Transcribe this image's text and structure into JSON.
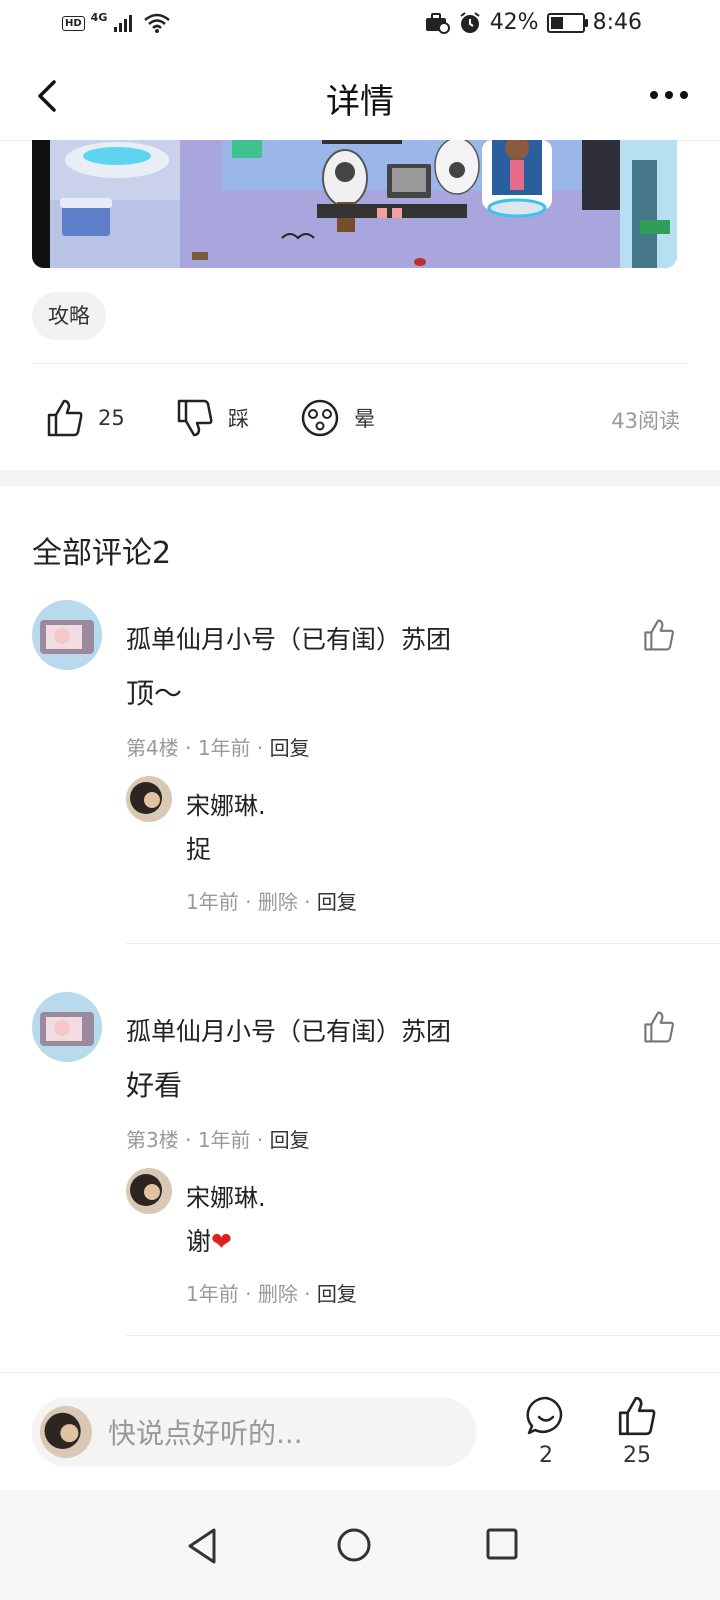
{
  "status_bar": {
    "hd": "HD",
    "network": "4G",
    "battery": "42%",
    "battery_level": 0.42,
    "time": "8:46"
  },
  "header": {
    "title": "详情"
  },
  "post": {
    "tag": "攻略",
    "like_count": "25",
    "dislike_label": "踩",
    "dizzy_label": "晕",
    "reads": "43阅读"
  },
  "comments_section": {
    "title": "全部评论2",
    "comments": [
      {
        "author": "孤单仙月小号（已有闺）苏团",
        "text": "顶～",
        "floor": "第4楼",
        "time": "1年前",
        "reply": "回复",
        "replies": [
          {
            "author": "宋娜琳.",
            "text": "捉",
            "time": "1年前",
            "delete": "删除",
            "reply": "回复"
          }
        ]
      },
      {
        "author": "孤单仙月小号（已有闺）苏团",
        "text": "好看",
        "floor": "第3楼",
        "time": "1年前",
        "reply": "回复",
        "replies": [
          {
            "author": "宋娜琳.",
            "text": "谢",
            "emoji": "❤",
            "time": "1年前",
            "delete": "删除",
            "reply": "回复"
          }
        ]
      }
    ]
  },
  "bottom_bar": {
    "placeholder": "快说点好听的...",
    "comment_count": "2",
    "like_count": "25"
  },
  "colors": {
    "heart": "#e02020",
    "muted": "#999999",
    "divider": "#ececec"
  }
}
